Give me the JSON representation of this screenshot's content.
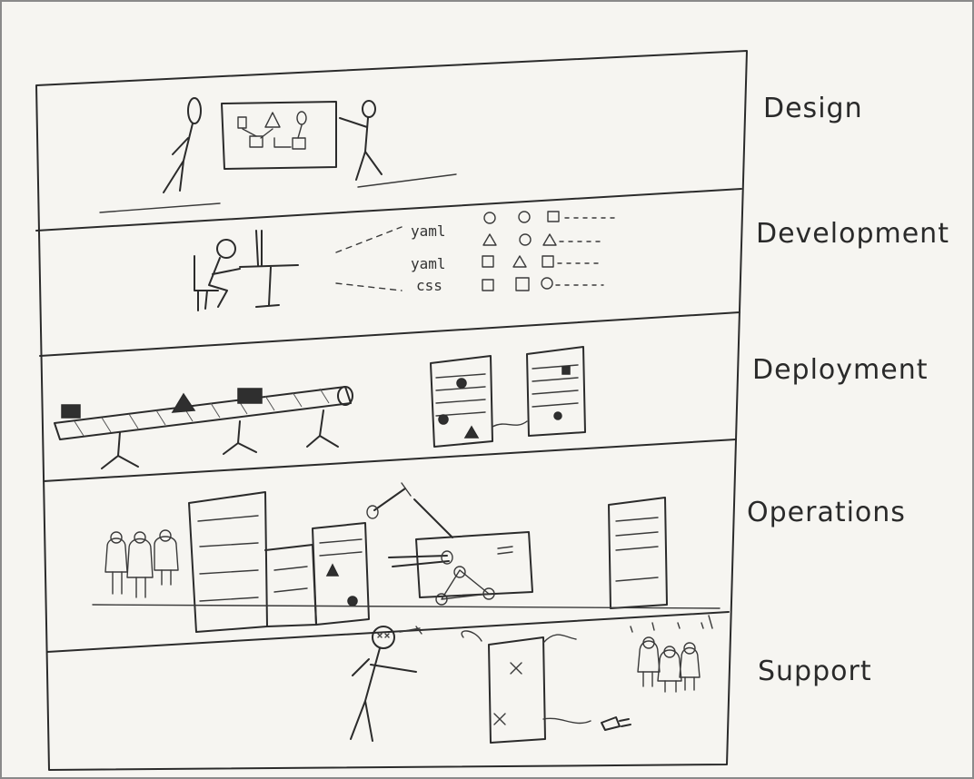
{
  "stages": [
    {
      "label": "Design"
    },
    {
      "label": "Development"
    },
    {
      "label": "Deployment"
    },
    {
      "label": "Operations"
    },
    {
      "label": "Support"
    }
  ],
  "development_files": [
    "yaml",
    "yaml",
    "css"
  ]
}
